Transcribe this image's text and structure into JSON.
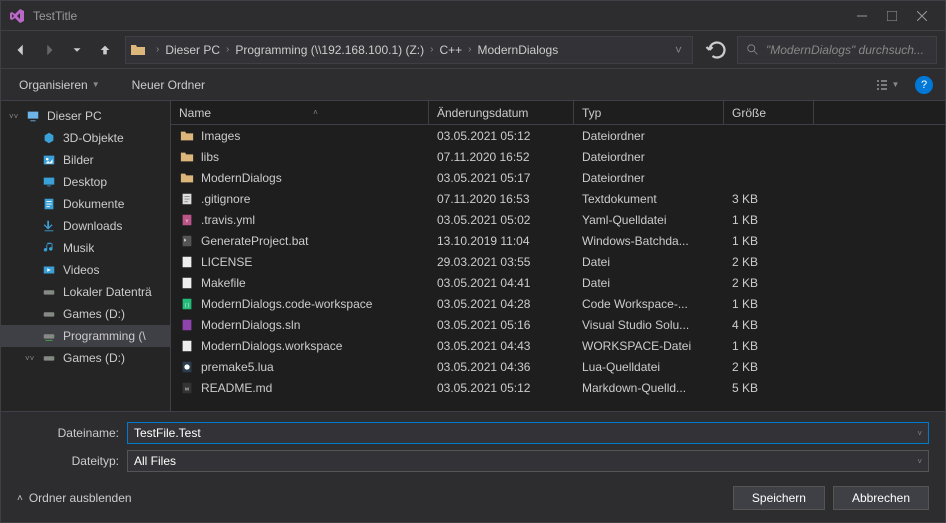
{
  "window": {
    "title": "TestTitle"
  },
  "breadcrumbs": [
    "Dieser PC",
    "Programming (\\\\192.168.100.1) (Z:)",
    "C++",
    "ModernDialogs"
  ],
  "search": {
    "placeholder": "\"ModernDialogs\" durchsuch..."
  },
  "toolbar": {
    "organize": "Organisieren",
    "newFolder": "Neuer Ordner"
  },
  "sidebar": [
    {
      "label": "Dieser PC",
      "icon": "pc",
      "expanded": true,
      "indent": false
    },
    {
      "label": "3D-Objekte",
      "icon": "3d",
      "indent": true
    },
    {
      "label": "Bilder",
      "icon": "pictures",
      "indent": true
    },
    {
      "label": "Desktop",
      "icon": "desktop",
      "indent": true
    },
    {
      "label": "Dokumente",
      "icon": "docs",
      "indent": true
    },
    {
      "label": "Downloads",
      "icon": "downloads",
      "indent": true
    },
    {
      "label": "Musik",
      "icon": "music",
      "indent": true
    },
    {
      "label": "Videos",
      "icon": "videos",
      "indent": true
    },
    {
      "label": "Lokaler Datenträ",
      "icon": "drive",
      "indent": true
    },
    {
      "label": "Games (D:)",
      "icon": "drive",
      "indent": true
    },
    {
      "label": "Programming (\\",
      "icon": "netdrive",
      "indent": true,
      "selected": true
    },
    {
      "label": "Games (D:)",
      "icon": "drive",
      "indent": true,
      "expanded": true
    }
  ],
  "columns": {
    "name": "Name",
    "date": "Änderungsdatum",
    "type": "Typ",
    "size": "Größe"
  },
  "files": [
    {
      "name": "Images",
      "date": "03.05.2021 05:12",
      "type": "Dateiordner",
      "size": "",
      "icon": "folder"
    },
    {
      "name": "libs",
      "date": "07.11.2020 16:52",
      "type": "Dateiordner",
      "size": "",
      "icon": "folder"
    },
    {
      "name": "ModernDialogs",
      "date": "03.05.2021 05:17",
      "type": "Dateiordner",
      "size": "",
      "icon": "folder"
    },
    {
      "name": ".gitignore",
      "date": "07.11.2020 16:53",
      "type": "Textdokument",
      "size": "3 KB",
      "icon": "text"
    },
    {
      "name": ".travis.yml",
      "date": "03.05.2021 05:02",
      "type": "Yaml-Quelldatei",
      "size": "1 KB",
      "icon": "yaml"
    },
    {
      "name": "GenerateProject.bat",
      "date": "13.10.2019 11:04",
      "type": "Windows-Batchda...",
      "size": "1 KB",
      "icon": "bat"
    },
    {
      "name": "LICENSE",
      "date": "29.03.2021 03:55",
      "type": "Datei",
      "size": "2 KB",
      "icon": "file"
    },
    {
      "name": "Makefile",
      "date": "03.05.2021 04:41",
      "type": "Datei",
      "size": "2 KB",
      "icon": "file"
    },
    {
      "name": "ModernDialogs.code-workspace",
      "date": "03.05.2021 04:28",
      "type": "Code Workspace-...",
      "size": "1 KB",
      "icon": "code"
    },
    {
      "name": "ModernDialogs.sln",
      "date": "03.05.2021 05:16",
      "type": "Visual Studio Solu...",
      "size": "4 KB",
      "icon": "sln"
    },
    {
      "name": "ModernDialogs.workspace",
      "date": "03.05.2021 04:43",
      "type": "WORKSPACE-Datei",
      "size": "1 KB",
      "icon": "file"
    },
    {
      "name": "premake5.lua",
      "date": "03.05.2021 04:36",
      "type": "Lua-Quelldatei",
      "size": "2 KB",
      "icon": "lua"
    },
    {
      "name": "README.md",
      "date": "03.05.2021 05:12",
      "type": "Markdown-Quelld...",
      "size": "5 KB",
      "icon": "md"
    }
  ],
  "form": {
    "filenameLabel": "Dateiname:",
    "filenameValue": "TestFile.Test",
    "filetypeLabel": "Dateityp:",
    "filetypeValue": "All Files",
    "hideFolders": "Ordner ausblenden",
    "save": "Speichern",
    "cancel": "Abbrechen"
  },
  "helpTooltip": "?"
}
